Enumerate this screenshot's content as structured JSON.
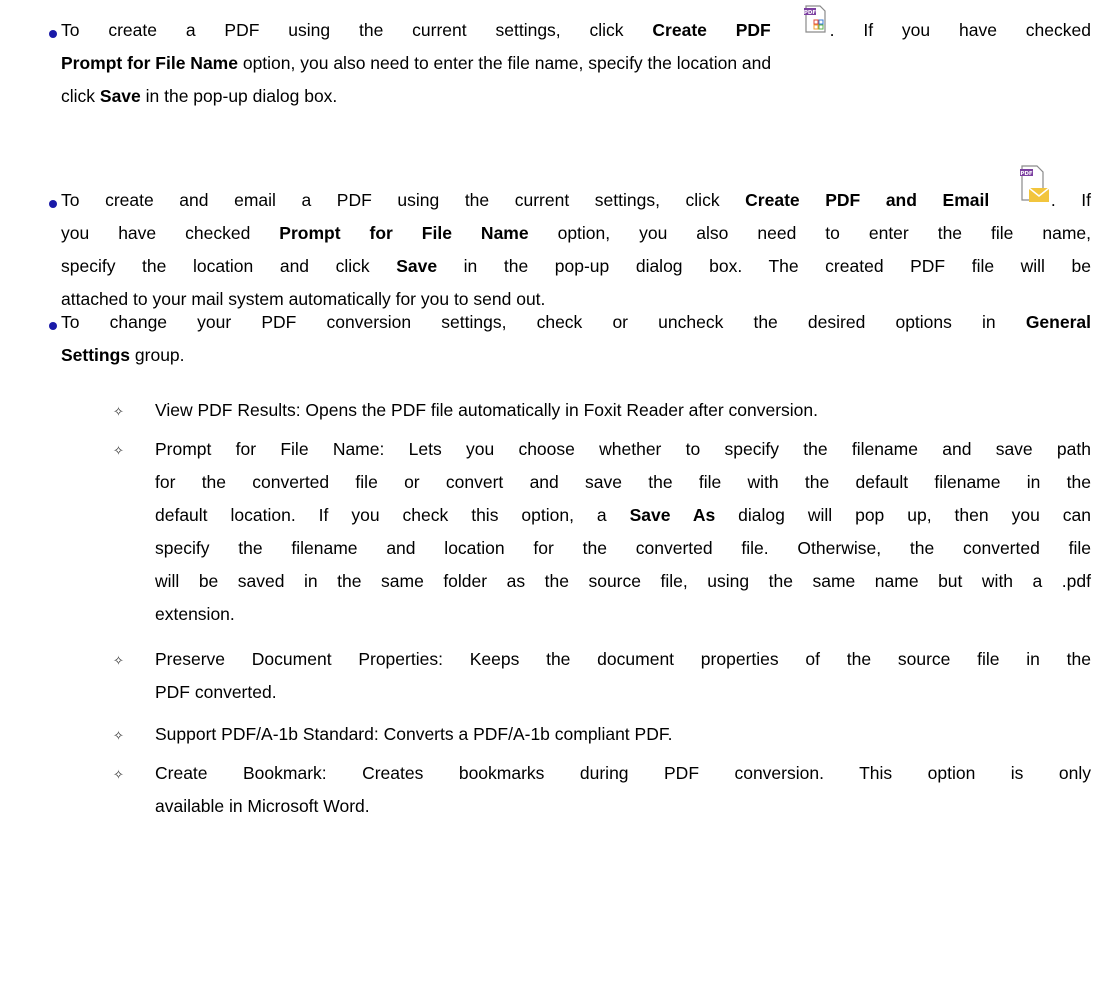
{
  "bullets": [
    {
      "lines": [
        [
          "To create a PDF using the current settings, click ",
          "Create PDF",
          "ICON1",
          ". If you have checked"
        ],
        [
          "Prompt for File Name",
          " option, you also need to enter the file name, specify the location and"
        ],
        [
          "click ",
          "Save",
          " in the pop-up dialog box."
        ]
      ]
    }
  ],
  "b1": {
    "l1a": "To create a PDF using the current settings, click ",
    "l1b": "Create PDF",
    "l1c": ". If you have checked",
    "l2a": "Prompt for File Name",
    "l2b": " option, you also need to enter the file name, specify the location and",
    "l3a": "click ",
    "l3b": "Save",
    "l3c": " in the pop-up dialog box."
  },
  "b2": {
    "l1a": "To create and email a PDF using the current settings, click ",
    "l1b": "Create PDF and Email",
    "l1c": ". If",
    "l2a": "you have checked ",
    "l2b": "Prompt for File Name",
    "l2c": " option, you also need to enter the file name,",
    "l3a": "specify the location and click ",
    "l3b": "Save",
    "l3c": " in the pop-up dialog box. The created PDF file will be",
    "l4": "attached to your mail system automatically for you to send out."
  },
  "b3": {
    "l1a": "To change your PDF conversion settings, check or uncheck the desired options in ",
    "l1b": "General",
    "l2a": "Settings",
    "l2b": " group."
  },
  "s1": {
    "l1": "View PDF Results: Opens the PDF file automatically in Foxit Reader after conversion."
  },
  "s2": {
    "l1": "Prompt for File Name: Lets you choose whether to specify the filename and save path",
    "l2": "for the converted file or convert and save the file with the default filename in the",
    "l3a": "default location. If you check this option, a ",
    "l3b": "Save As",
    "l3c": " dialog will pop up, then you can",
    "l4": "specify the filename and location for the converted file. Otherwise, the converted file",
    "l5": "will be saved in the same folder as the source file, using the same name but with a .pdf",
    "l6": "extension."
  },
  "s3": {
    "l1": "Preserve Document Properties: Keeps the document properties of the source file in the",
    "l2": "PDF converted."
  },
  "s4": {
    "l1": "Support PDF/A-1b Standard: Converts a PDF/A-1b compliant PDF."
  },
  "s5": {
    "l1": "Create Bookmark: Creates bookmarks during PDF conversion. This option is only",
    "l2": "available in Microsoft Word."
  },
  "diamond_glyph": "✧",
  "icons": {
    "create_pdf": "create-pdf-icon",
    "create_pdf_email": "create-pdf-email-icon",
    "pdf_label": "PDF"
  },
  "colors": {
    "bullet": "#1a1aa8",
    "pdf_badge": "#7b3fa0",
    "envelope": "#f2c53d"
  }
}
